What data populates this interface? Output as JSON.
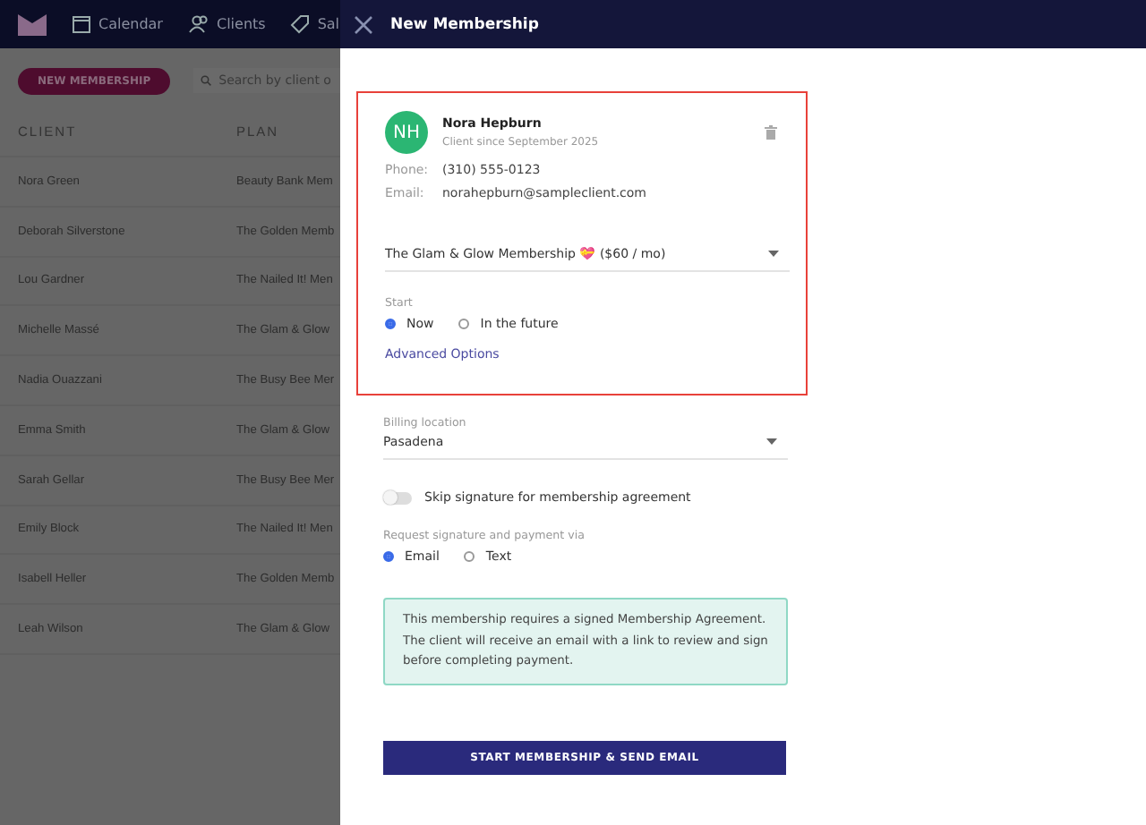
{
  "nav": {
    "items": [
      {
        "label": "Calendar"
      },
      {
        "label": "Clients"
      },
      {
        "label": "Sal"
      }
    ]
  },
  "page": {
    "new_button": "NEW MEMBERSHIP",
    "search": {
      "placeholder": "Search by client o"
    },
    "table": {
      "columns": [
        "CLIENT",
        "PLAN"
      ],
      "rows": [
        {
          "client": "Nora Green",
          "plan": "Beauty Bank Mem"
        },
        {
          "client": "Deborah Silverstone",
          "plan": "The Golden Memb"
        },
        {
          "client": "Lou Gardner",
          "plan": "The Nailed It! Men"
        },
        {
          "client": "Michelle Massé",
          "plan": "The Glam & Glow"
        },
        {
          "client": "Nadia Ouazzani",
          "plan": "The Busy Bee Mer"
        },
        {
          "client": "Emma Smith",
          "plan": "The Glam & Glow"
        },
        {
          "client": "Sarah Gellar",
          "plan": "The Busy Bee Mer"
        },
        {
          "client": "Emily Block",
          "plan": "The Nailed It! Men"
        },
        {
          "client": "Isabell Heller",
          "plan": "The Golden Memb"
        },
        {
          "client": "Leah Wilson",
          "plan": "The Glam & Glow"
        }
      ]
    }
  },
  "drawer": {
    "title": "New Membership",
    "client": {
      "initials": "NH",
      "name": "Nora Hepburn",
      "since": "Client since September 2025",
      "fields": [
        {
          "label": "Phone:",
          "value": "(310) 555-0123"
        },
        {
          "label": "Email:",
          "value": "norahepburn@sampleclient.com"
        }
      ]
    },
    "plan_select": {
      "value": "The Glam & Glow Membership 💝 ($60 / mo)"
    },
    "start": {
      "label": "Start",
      "options": [
        {
          "label": "Now",
          "selected": true
        },
        {
          "label": "In the future",
          "selected": false
        }
      ]
    },
    "advanced_link": "Advanced Options",
    "billing": {
      "label": "Billing location",
      "value": "Pasadena"
    },
    "skip_toggle": {
      "label": "Skip signature for membership agreement",
      "on": false
    },
    "request": {
      "label": "Request signature and payment via",
      "options": [
        {
          "label": "Email",
          "selected": true
        },
        {
          "label": "Text",
          "selected": false
        }
      ]
    },
    "notice": "This membership requires a signed Membership Agreement. The client will receive an email with a link to review and sign before completing payment.",
    "submit": "START MEMBERSHIP & SEND EMAIL"
  }
}
